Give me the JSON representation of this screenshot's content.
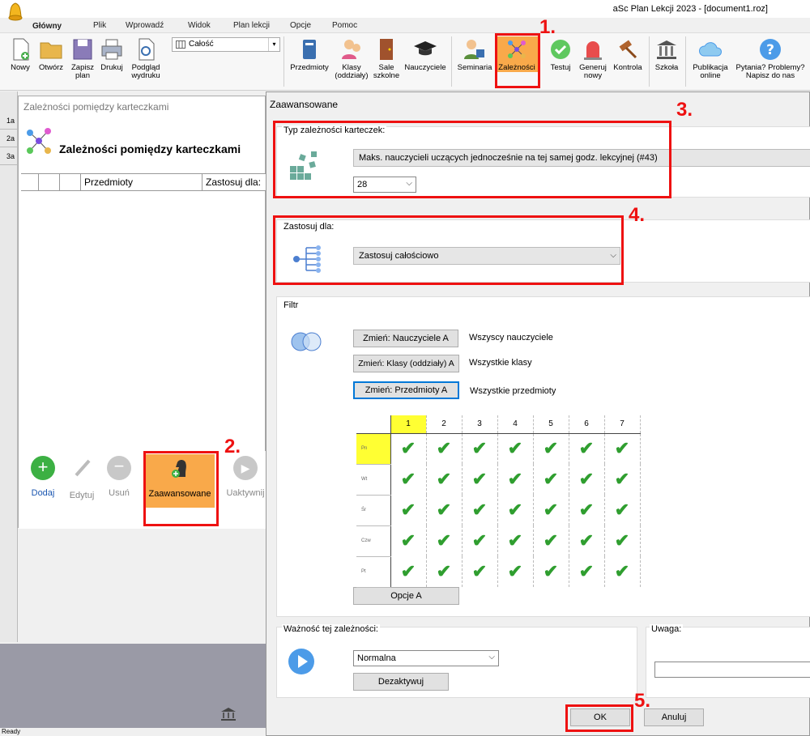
{
  "app": {
    "title": "aSc Plan Lekcji 2023 - [document1.roz]",
    "status": "Ready"
  },
  "tabs": [
    "Główny",
    "Plik",
    "Wprowadź",
    "Widok",
    "Plan lekcji",
    "Opcje",
    "Pomoc"
  ],
  "ribbon": {
    "new": "Nowy",
    "open": "Otwórz",
    "save": "Zapisz\nplan",
    "print": "Drukuj",
    "preview": "Podgląd\nwydruku",
    "scope_value": "Całość",
    "subjects": "Przedmioty",
    "classes": "Klasy\n(oddziały)",
    "rooms": "Sale\nszkolne",
    "teachers": "Nauczyciele",
    "seminars": "Seminaria",
    "dependencies": "Zależności",
    "test": "Testuj",
    "generate": "Generuj\nnowy",
    "control": "Kontrola",
    "school": "Szkoła",
    "publish": "Publikacja\nonline",
    "help": "Pytania? Problemy?\nNapisz do nas"
  },
  "left_rows": [
    "1a",
    "2a",
    "3a"
  ],
  "card_window": {
    "title": "Zależności pomiędzy karteczkami",
    "header": "Zależności pomiędzy karteczkami",
    "columns": [
      "Przedmioty",
      "Zastosuj dla:"
    ],
    "buttons": {
      "add": "Dodaj",
      "edit": "Edytuj",
      "remove": "Usuń",
      "advanced": "Zaawansowane",
      "activate": "Uaktywnij"
    }
  },
  "dialog": {
    "title": "Zaawansowane",
    "type_group": "Typ zależności karteczek:",
    "type_value": "Maks. nauczycieli uczących jednocześnie na tej samej godz. lekcyjnej (#43)",
    "type_number": "28",
    "apply_group": "Zastosuj dla:",
    "apply_value": "Zastosuj całościowo",
    "filter_group": "Filtr",
    "filter_teachers_btn": "Zmień: Nauczyciele A",
    "filter_teachers_val": "Wszyscy nauczyciele",
    "filter_classes_btn": "Zmień: Klasy (oddziały) A",
    "filter_classes_val": "Wszystkie klasy",
    "filter_subjects_btn": "Zmień: Przedmioty A",
    "filter_subjects_val": "Wszystkie przedmioty",
    "periods": [
      "1",
      "2",
      "3",
      "4",
      "5",
      "6",
      "7"
    ],
    "days": [
      "Pn",
      "Wt",
      "Śr",
      "Czw",
      "Pt"
    ],
    "options_btn": "Opcje A",
    "importance_group": "Ważność tej zależności:",
    "importance_value": "Normalna",
    "deactivate_btn": "Dezaktywuj",
    "note_group": "Uwaga:",
    "ok": "OK",
    "cancel": "Anuluj"
  },
  "annotations": [
    "1.",
    "2.",
    "3.",
    "4.",
    "5."
  ]
}
